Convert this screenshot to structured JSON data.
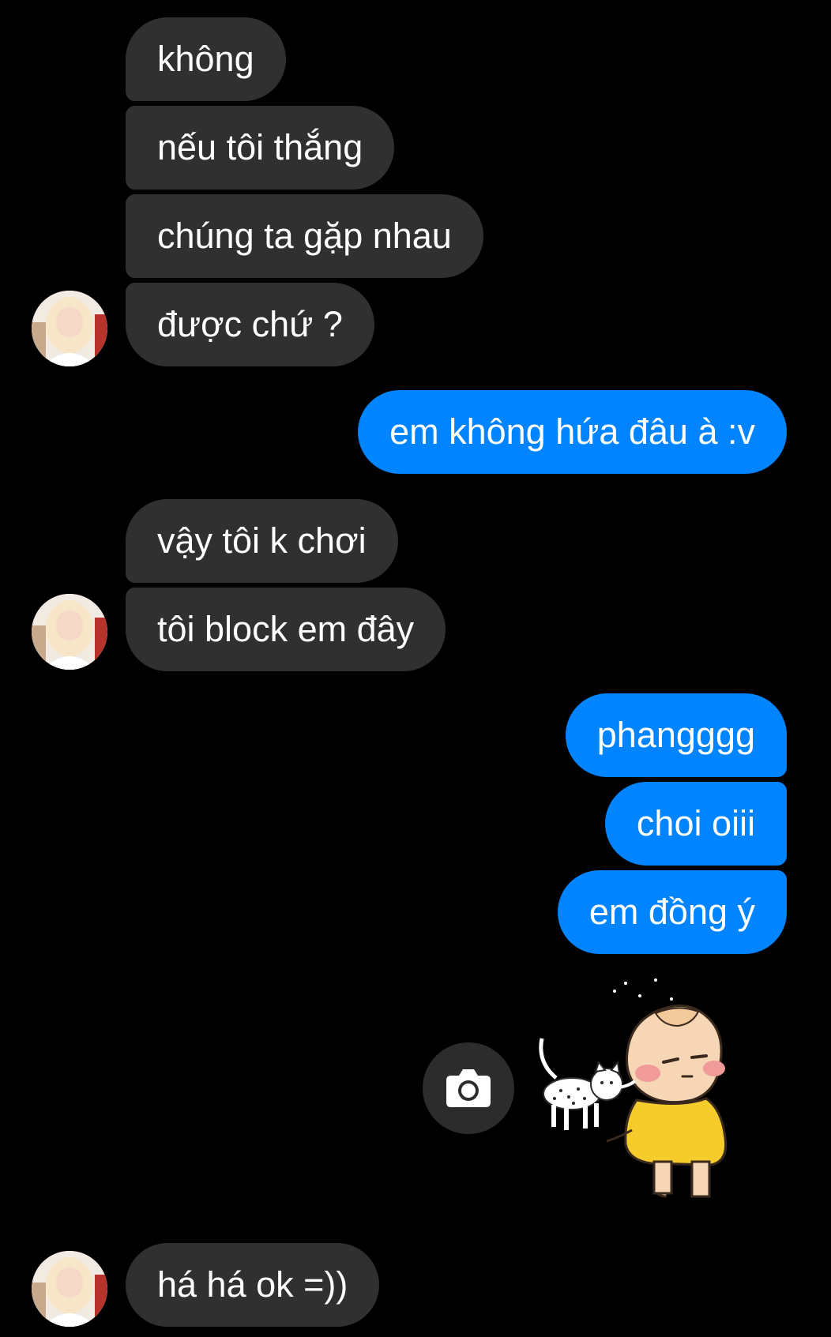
{
  "conversation": {
    "messages": [
      {
        "sender": "them",
        "text": "không"
      },
      {
        "sender": "them",
        "text": "nếu tôi thắng"
      },
      {
        "sender": "them",
        "text": "chúng ta gặp nhau"
      },
      {
        "sender": "them",
        "text": "được chứ ?"
      },
      {
        "sender": "me",
        "text": "em không hứa đâu à :v"
      },
      {
        "sender": "them",
        "text": "vậy tôi k chơi"
      },
      {
        "sender": "them",
        "text": "tôi block em đây"
      },
      {
        "sender": "me",
        "text": "phangggg"
      },
      {
        "sender": "me",
        "text": "choi oiii"
      },
      {
        "sender": "me",
        "text": "em đồng ý"
      },
      {
        "sender": "me",
        "type": "sticker",
        "sticker": "baby-with-cat-sticker"
      },
      {
        "sender": "them",
        "text": "há há ok =))"
      }
    ]
  },
  "icons": {
    "camera": "camera-icon",
    "avatar": "contact-avatar"
  },
  "colors": {
    "background": "#000000",
    "incoming_bubble": "#303030",
    "outgoing_bubble": "#0084ff",
    "text": "#ffffff"
  }
}
